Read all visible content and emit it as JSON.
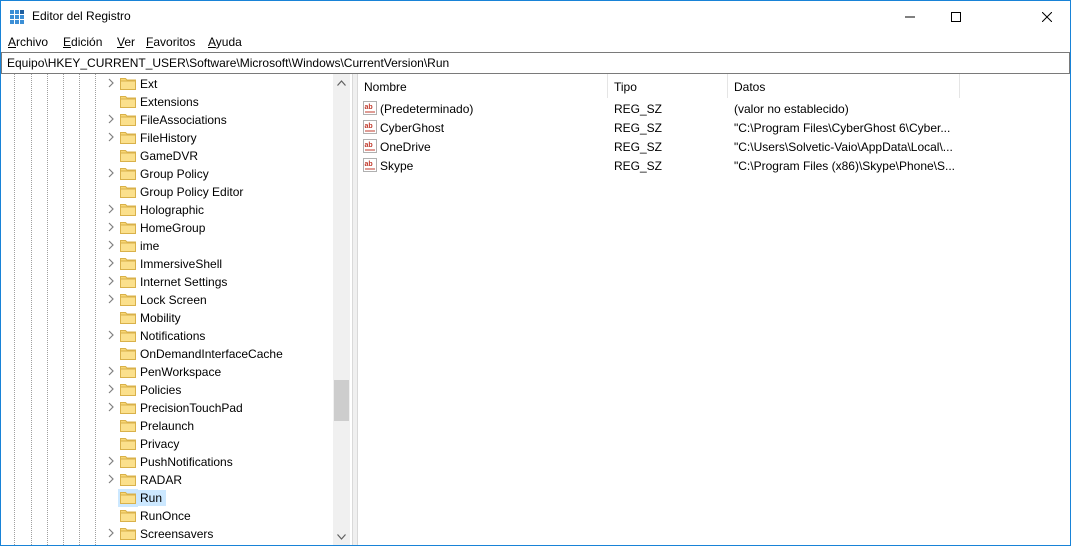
{
  "window": {
    "title": "Editor del Registro"
  },
  "menu": [
    {
      "mnemonic": "A",
      "rest": "rchivo"
    },
    {
      "mnemonic": "E",
      "rest": "dición"
    },
    {
      "mnemonic": "V",
      "rest": "er"
    },
    {
      "mnemonic": "F",
      "rest": "avoritos"
    },
    {
      "mnemonic": "A",
      "rest": "yuda"
    }
  ],
  "address": {
    "path": "Equipo\\HKEY_CURRENT_USER\\Software\\Microsoft\\Windows\\CurrentVersion\\Run"
  },
  "tree": {
    "items": [
      {
        "label": "Ext",
        "expandable": true
      },
      {
        "label": "Extensions",
        "expandable": false
      },
      {
        "label": "FileAssociations",
        "expandable": true
      },
      {
        "label": "FileHistory",
        "expandable": true
      },
      {
        "label": "GameDVR",
        "expandable": false
      },
      {
        "label": "Group Policy",
        "expandable": true
      },
      {
        "label": "Group Policy Editor",
        "expandable": false
      },
      {
        "label": "Holographic",
        "expandable": true
      },
      {
        "label": "HomeGroup",
        "expandable": true
      },
      {
        "label": "ime",
        "expandable": true
      },
      {
        "label": "ImmersiveShell",
        "expandable": true
      },
      {
        "label": "Internet Settings",
        "expandable": true
      },
      {
        "label": "Lock Screen",
        "expandable": true
      },
      {
        "label": "Mobility",
        "expandable": false
      },
      {
        "label": "Notifications",
        "expandable": true
      },
      {
        "label": "OnDemandInterfaceCache",
        "expandable": false
      },
      {
        "label": "PenWorkspace",
        "expandable": true
      },
      {
        "label": "Policies",
        "expandable": true
      },
      {
        "label": "PrecisionTouchPad",
        "expandable": true
      },
      {
        "label": "Prelaunch",
        "expandable": false
      },
      {
        "label": "Privacy",
        "expandable": false
      },
      {
        "label": "PushNotifications",
        "expandable": true
      },
      {
        "label": "RADAR",
        "expandable": true
      },
      {
        "label": "Run",
        "expandable": false,
        "selected": true
      },
      {
        "label": "RunOnce",
        "expandable": false
      },
      {
        "label": "Screensavers",
        "expandable": true
      }
    ]
  },
  "values": {
    "columns": [
      "Nombre",
      "Tipo",
      "Datos"
    ],
    "rows": [
      {
        "name": "(Predeterminado)",
        "type": "REG_SZ",
        "data": "(valor no establecido)"
      },
      {
        "name": "CyberGhost",
        "type": "REG_SZ",
        "data": "\"C:\\Program Files\\CyberGhost 6\\Cyber..."
      },
      {
        "name": "OneDrive",
        "type": "REG_SZ",
        "data": "\"C:\\Users\\Solvetic-Vaio\\AppData\\Local\\..."
      },
      {
        "name": "Skype",
        "type": "REG_SZ",
        "data": "\"C:\\Program Files (x86)\\Skype\\Phone\\S..."
      }
    ]
  },
  "colors": {
    "selection": "#cce8ff",
    "border": "#1883d7",
    "folder": "#f8d775"
  }
}
